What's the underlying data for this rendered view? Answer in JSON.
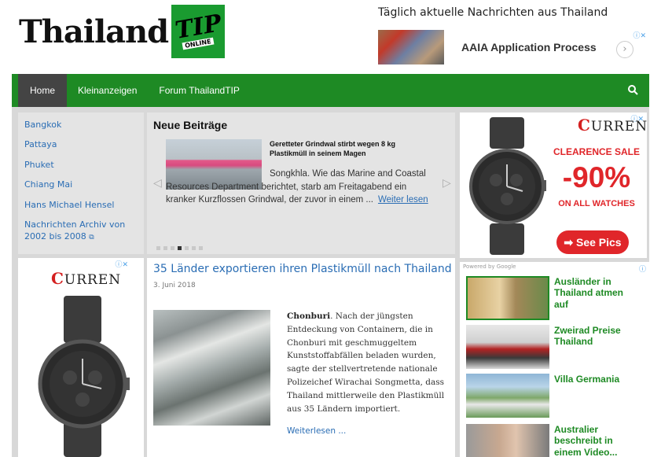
{
  "header": {
    "logo_word": "Thailand",
    "logo_badge": "TIP",
    "logo_sub": "ONLINE",
    "tagline": "Täglich aktuelle Nachrichten aus Thailand"
  },
  "top_ad": {
    "title": "AAIA Application Process",
    "arrow": "›"
  },
  "nav": {
    "items": [
      {
        "label": "Home",
        "active": true
      },
      {
        "label": "Kleinanzeigen"
      },
      {
        "label": "Forum ThailandTIP"
      }
    ],
    "search_icon": "search-icon"
  },
  "sidebar": {
    "links": [
      {
        "label": "Bangkok"
      },
      {
        "label": "Pattaya"
      },
      {
        "label": "Phuket"
      },
      {
        "label": "Chiang Mai"
      },
      {
        "label": "Hans Michael Hensel"
      },
      {
        "label": "Nachrichten Archiv von 2002 bis 2008"
      }
    ]
  },
  "neue_beitraege": {
    "heading": "Neue Beiträge",
    "slide_headline": "Geretteter Grindwal stirbt wegen 8 kg Plastikmüll in seinem Magen",
    "slide_text": "Songkhla. Wie das Marine and Coastal Resources Department berichtet, starb am Freitagabend ein kranker Kurzflossen Grindwal, der zuvor in einem ...",
    "slide_more": "Weiter lesen",
    "dots_total": 7,
    "dots_active": 3
  },
  "article": {
    "title": "35 Länder exportieren ihren Plastikmüll nach Thailand",
    "date": "3. Juni 2018",
    "lead_place": "Chonburi",
    "body": ". Nach der jüngsten Entdeckung von Containern, die in Chonburi mit geschmuggeltem Kunststoffabfällen beladen wurden, sagte der stellvertretende nationale Polizeichef Wirachai Songmetta, dass Thailand mittlerweile den Plastikmüll aus 35 Ländern importiert.",
    "more": "Weiterlesen ..."
  },
  "ad_right": {
    "brand_initial": "C",
    "brand_rest": "URREN",
    "line1": "CLEARENCE SALE",
    "line2": "-90%",
    "line3": "ON ALL WATCHES",
    "button": "➡ See Pics"
  },
  "ad_left": {
    "brand_initial": "C",
    "brand_rest": "URREN"
  },
  "recommended": {
    "label": "Powered by Google",
    "items": [
      {
        "text": "Ausländer in Thailand atmen auf"
      },
      {
        "text": "Zweirad Preise Thailand"
      },
      {
        "text": "Villa Germania"
      },
      {
        "text": "Australier beschreibt in einem Video..."
      }
    ]
  },
  "colors": {
    "nav_green": "#1e8a24",
    "link_blue": "#2a6db4",
    "sale_red": "#e0262a",
    "rec_green": "#1e8a24"
  }
}
